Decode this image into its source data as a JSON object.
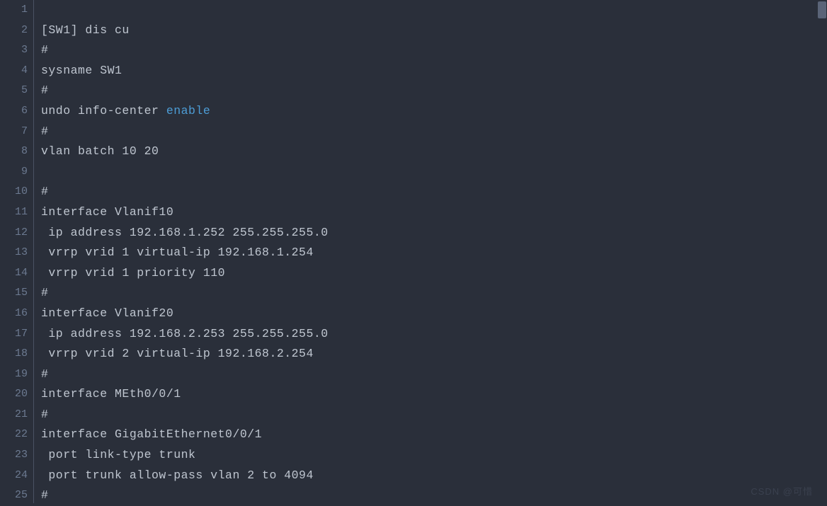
{
  "lines": [
    {
      "num": "1",
      "segments": [
        {
          "text": "",
          "class": ""
        }
      ]
    },
    {
      "num": "2",
      "segments": [
        {
          "text": "[SW1] dis cu",
          "class": ""
        }
      ]
    },
    {
      "num": "3",
      "segments": [
        {
          "text": "#",
          "class": ""
        }
      ]
    },
    {
      "num": "4",
      "segments": [
        {
          "text": "sysname SW1",
          "class": ""
        }
      ]
    },
    {
      "num": "5",
      "segments": [
        {
          "text": "#",
          "class": ""
        }
      ]
    },
    {
      "num": "6",
      "segments": [
        {
          "text": "undo info-center ",
          "class": ""
        },
        {
          "text": "enable",
          "class": "keyword-enable"
        }
      ]
    },
    {
      "num": "7",
      "segments": [
        {
          "text": "#",
          "class": ""
        }
      ]
    },
    {
      "num": "8",
      "segments": [
        {
          "text": "vlan batch 10 20",
          "class": ""
        }
      ]
    },
    {
      "num": "9",
      "segments": [
        {
          "text": "",
          "class": ""
        }
      ]
    },
    {
      "num": "10",
      "segments": [
        {
          "text": "#",
          "class": ""
        }
      ]
    },
    {
      "num": "11",
      "segments": [
        {
          "text": "interface Vlanif10",
          "class": ""
        }
      ]
    },
    {
      "num": "12",
      "segments": [
        {
          "text": " ip address 192.168.1.252 255.255.255.0",
          "class": ""
        }
      ]
    },
    {
      "num": "13",
      "segments": [
        {
          "text": " vrrp vrid 1 virtual-ip 192.168.1.254",
          "class": ""
        }
      ]
    },
    {
      "num": "14",
      "segments": [
        {
          "text": " vrrp vrid 1 priority 110",
          "class": ""
        }
      ]
    },
    {
      "num": "15",
      "segments": [
        {
          "text": "#",
          "class": ""
        }
      ]
    },
    {
      "num": "16",
      "segments": [
        {
          "text": "interface Vlanif20",
          "class": ""
        }
      ]
    },
    {
      "num": "17",
      "segments": [
        {
          "text": " ip address 192.168.2.253 255.255.255.0",
          "class": ""
        }
      ]
    },
    {
      "num": "18",
      "segments": [
        {
          "text": " vrrp vrid 2 virtual-ip 192.168.2.254",
          "class": ""
        }
      ]
    },
    {
      "num": "19",
      "segments": [
        {
          "text": "#",
          "class": ""
        }
      ]
    },
    {
      "num": "20",
      "segments": [
        {
          "text": "interface MEth0/0/1",
          "class": ""
        }
      ]
    },
    {
      "num": "21",
      "segments": [
        {
          "text": "#",
          "class": ""
        }
      ]
    },
    {
      "num": "22",
      "segments": [
        {
          "text": "interface GigabitEthernet0/0/1",
          "class": ""
        }
      ]
    },
    {
      "num": "23",
      "segments": [
        {
          "text": " port link-type trunk",
          "class": ""
        }
      ]
    },
    {
      "num": "24",
      "segments": [
        {
          "text": " port trunk allow-pass vlan 2 to 4094",
          "class": ""
        }
      ]
    },
    {
      "num": "25",
      "segments": [
        {
          "text": "#",
          "class": ""
        }
      ]
    }
  ],
  "watermark": "CSDN @可惜",
  "watermark2": ""
}
